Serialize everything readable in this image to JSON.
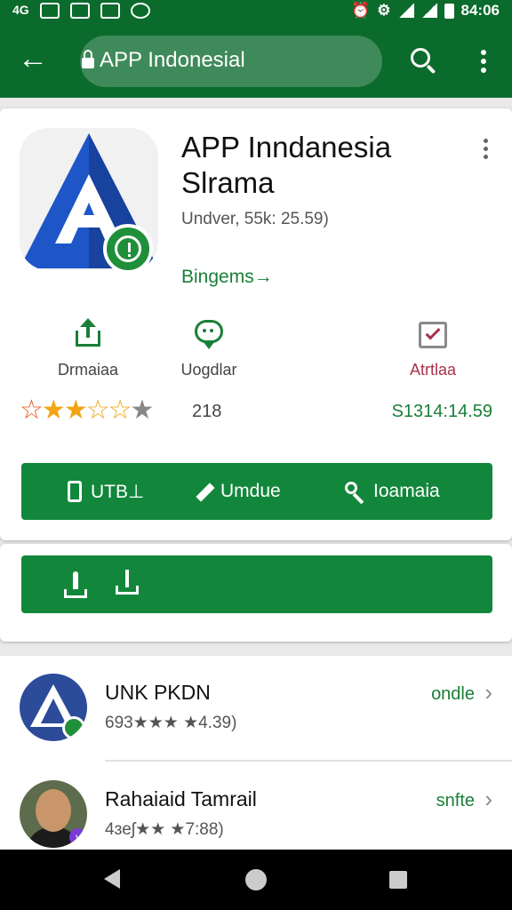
{
  "status_bar": {
    "left_icons": [
      "notification-icon",
      "message-icon",
      "image-icon",
      "calendar-icon",
      "chat-icon"
    ],
    "left_labels": [
      "4G",
      "",
      "",
      "",
      ""
    ],
    "time": "84:06"
  },
  "app_bar": {
    "search_text": "APP Indonesial"
  },
  "app": {
    "title": "APP Inndanesia\nSlrama",
    "meta": "Undver, 55k: 25.59)",
    "developer_link": "Bingems→",
    "actions": [
      {
        "label": "Drmaiaa"
      },
      {
        "label": "Uogdlar"
      },
      {
        "label": "Atrtlaa"
      }
    ],
    "rating_count": "218",
    "price": "S1314:14.59",
    "buttons": [
      {
        "label": "UTB⊥"
      },
      {
        "label": "Umdue"
      },
      {
        "label": "Ioamaia"
      }
    ]
  },
  "list": {
    "items": [
      {
        "name": "UNK PKDN",
        "sub": "693★★★ ★4.39)",
        "action": "ondle"
      },
      {
        "name": "Rahaiaid Tamrail",
        "sub": "4ɜeʃ★★ ★7:88)",
        "action": "snfte"
      }
    ]
  },
  "colors": {
    "brand_green": "#0b6b2c",
    "button_green": "#12873b",
    "accent_red": "#a8324a",
    "star_gold": "#f2a413"
  }
}
